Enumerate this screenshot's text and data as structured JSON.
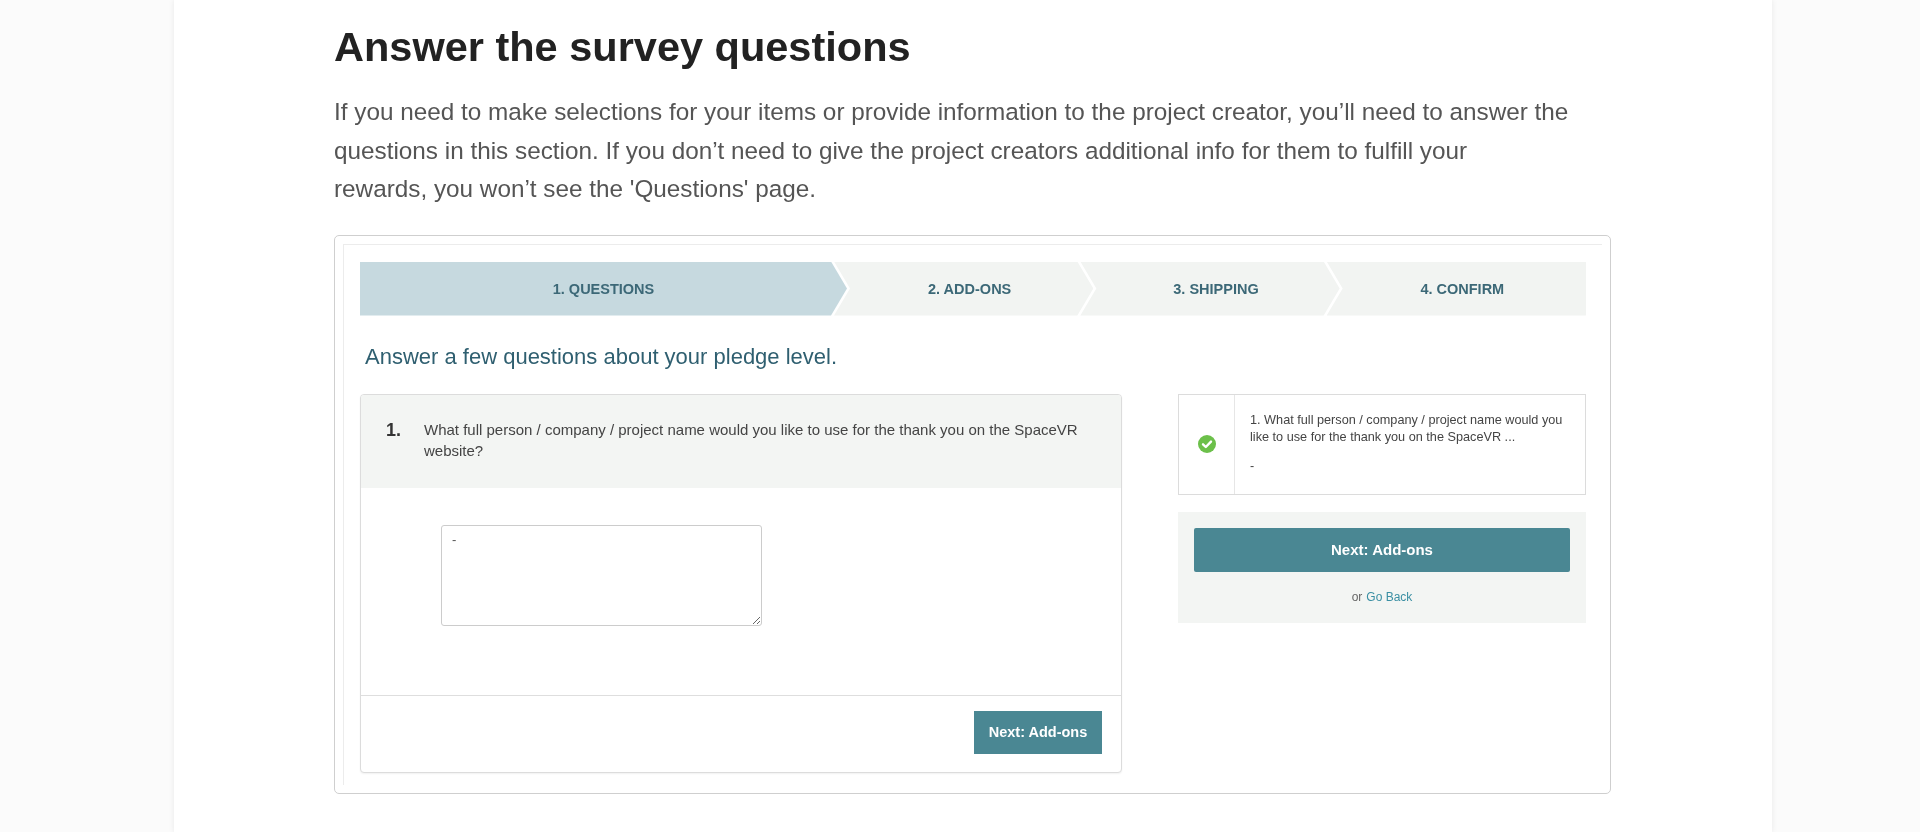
{
  "article": {
    "heading": "Answer the survey questions",
    "paragraph": "If you need to make selections for your items or provide information to the project creator, you’ll need to answer the questions in this section. If you don’t need to give the project creators additional info for them to fulfill your\nrewards, you won’t see the 'Questions' page."
  },
  "screenshot": {
    "steps": [
      {
        "label": "1. QUESTIONS",
        "selected": true
      },
      {
        "label": "2. ADD-ONS",
        "selected": false
      },
      {
        "label": "3. SHIPPING",
        "selected": false
      },
      {
        "label": "4. CONFIRM",
        "selected": false
      }
    ],
    "title": "Answer a few questions about your pledge level.",
    "question": {
      "number": "1.",
      "text": "What full person / company / project name would you like to use for the thank you on the SpaceVR website?",
      "answer": "-",
      "button": "Next: Add-ons"
    },
    "summary": {
      "items": [
        {
          "text": "1. What full person / company / project name would you like to use for the thank you on the SpaceVR ...",
          "answer": "-",
          "answered": true
        }
      ],
      "button": "Next: Add-ons",
      "back_prefix": "or",
      "back_link": "Go Back"
    }
  }
}
